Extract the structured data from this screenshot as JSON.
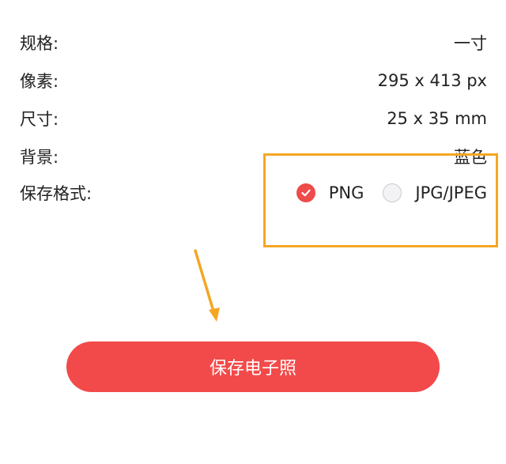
{
  "details": [
    {
      "label": "规格:",
      "value": "一寸"
    },
    {
      "label": "像素:",
      "value": "295 x 413 px"
    },
    {
      "label": "尺寸:",
      "value": "25 x 35 mm"
    },
    {
      "label": "背景:",
      "value": "蓝色"
    }
  ],
  "format": {
    "label": "保存格式:",
    "options": [
      {
        "label": "PNG",
        "checked": true
      },
      {
        "label": "JPG/JPEG",
        "checked": false
      }
    ]
  },
  "save_button_label": "保存电子照",
  "colors": {
    "accent": "#f24a4a",
    "annotation": "#f5a623"
  }
}
